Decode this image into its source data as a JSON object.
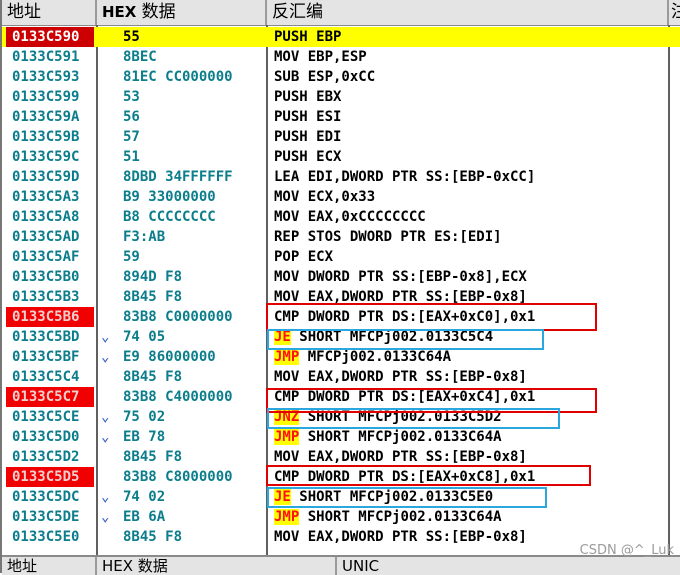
{
  "columns": {
    "address": "地址",
    "hex": "HEX",
    "hex_cn": "数据",
    "disasm": "反汇编",
    "comment": "注"
  },
  "rows": [
    {
      "addr": "0133C590",
      "hex": "55",
      "dis": "PUSH EBP",
      "mark": "",
      "addr_highlight": "selected"
    },
    {
      "addr": "0133C591",
      "hex": "8BEC",
      "dis": "MOV EBP,ESP",
      "mark": ""
    },
    {
      "addr": "0133C593",
      "hex": "81EC CC000000",
      "dis": "SUB ESP,0xCC",
      "mark": ""
    },
    {
      "addr": "0133C599",
      "hex": "53",
      "dis": "PUSH EBX",
      "mark": ""
    },
    {
      "addr": "0133C59A",
      "hex": "56",
      "dis": "PUSH ESI",
      "mark": ""
    },
    {
      "addr": "0133C59B",
      "hex": "57",
      "dis": "PUSH EDI",
      "mark": ""
    },
    {
      "addr": "0133C59C",
      "hex": "51",
      "dis": "PUSH ECX",
      "mark": ""
    },
    {
      "addr": "0133C59D",
      "hex": "8DBD 34FFFFFF",
      "dis": "LEA EDI,DWORD PTR SS:[EBP-0xCC]",
      "mark": ""
    },
    {
      "addr": "0133C5A3",
      "hex": "B9 33000000",
      "dis": "MOV ECX,0x33",
      "mark": ""
    },
    {
      "addr": "0133C5A8",
      "hex": "B8 CCCCCCCC",
      "dis": "MOV EAX,0xCCCCCCCC",
      "mark": ""
    },
    {
      "addr": "0133C5AD",
      "hex": "F3:AB",
      "dis": "REP STOS DWORD PTR ES:[EDI]",
      "mark": ""
    },
    {
      "addr": "0133C5AF",
      "hex": "59",
      "dis": "POP ECX",
      "mark": ""
    },
    {
      "addr": "0133C5B0",
      "hex": "894D F8",
      "dis": "MOV DWORD PTR SS:[EBP-0x8],ECX",
      "mark": ""
    },
    {
      "addr": "0133C5B3",
      "hex": "8B45 F8",
      "dis": "MOV EAX,DWORD PTR SS:[EBP-0x8]",
      "mark": ""
    },
    {
      "addr": "0133C5B6",
      "hex": "83B8 C0000000",
      "dis": "CMP DWORD PTR DS:[EAX+0xC0],0x1",
      "mark": "",
      "addr_highlight": "red"
    },
    {
      "addr": "0133C5BD",
      "hex": "74 05",
      "dis": "SHORT MFCPj002.0133C5C4",
      "jmp": "JE",
      "mark": "⌄"
    },
    {
      "addr": "0133C5BF",
      "hex": "E9 86000000",
      "dis": "MFCPj002.0133C64A",
      "jmp": "JMP",
      "mark": "⌄"
    },
    {
      "addr": "0133C5C4",
      "hex": "8B45 F8",
      "dis": "MOV EAX,DWORD PTR SS:[EBP-0x8]",
      "mark": ""
    },
    {
      "addr": "0133C5C7",
      "hex": "83B8 C4000000",
      "dis": "CMP DWORD PTR DS:[EAX+0xC4],0x1",
      "mark": "",
      "addr_highlight": "red"
    },
    {
      "addr": "0133C5CE",
      "hex": "75 02",
      "dis": "SHORT MFCPj002.0133C5D2",
      "jmp": "JNZ",
      "mark": "⌄"
    },
    {
      "addr": "0133C5D0",
      "hex": "EB 78",
      "dis": "SHORT MFCPj002.0133C64A",
      "jmp": "JMP",
      "mark": "⌄"
    },
    {
      "addr": "0133C5D2",
      "hex": "8B45 F8",
      "dis": "MOV EAX,DWORD PTR SS:[EBP-0x8]",
      "mark": ""
    },
    {
      "addr": "0133C5D5",
      "hex": "83B8 C8000000",
      "dis": "CMP DWORD PTR DS:[EAX+0xC8],0x1",
      "mark": "",
      "addr_highlight": "red"
    },
    {
      "addr": "0133C5DC",
      "hex": "74 02",
      "dis": "SHORT MFCPj002.0133C5E0",
      "jmp": "JE",
      "mark": "⌄"
    },
    {
      "addr": "0133C5DE",
      "hex": "EB 6A",
      "dis": "SHORT MFCPj002.0133C64A",
      "jmp": "JMP",
      "mark": "⌄"
    },
    {
      "addr": "0133C5E0",
      "hex": "8B45 F8",
      "dis": "MOV EAX,DWORD PTR SS:[EBP-0x8]",
      "mark": ""
    }
  ],
  "footer": {
    "address": "地址",
    "hex": "HEX 数据",
    "unicode": "UNIC"
  },
  "watermark": "CSDN @^_Luk",
  "colors": {
    "selected_row": "#ffff00",
    "address_text": "#0b7d8b",
    "jump_text": "#ff1111",
    "cmp_box": "#e00000",
    "jump_box": "#2aa7de"
  }
}
